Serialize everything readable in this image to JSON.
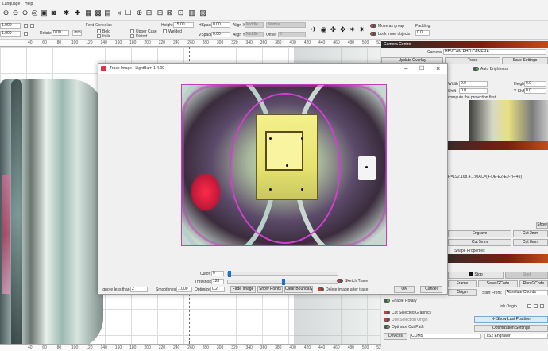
{
  "menu": {
    "items": [
      "Language",
      "Help"
    ]
  },
  "toolbar": {
    "icons": [
      "zoom-in",
      "zoom-out",
      "zoom-fit",
      "zoom-frame",
      "frame",
      "camera",
      "settings",
      "tools",
      "select",
      "trace",
      "text",
      "arrow",
      "position",
      "crosshair",
      "grid",
      "align",
      "arrange",
      "distribute"
    ]
  },
  "props": {
    "width_val": "1.000",
    "rotate_label": "Rotate",
    "rotate_val": "0.00",
    "unit": "mm",
    "font_label": "Font",
    "font_val": "Consolas",
    "height_label": "Height",
    "height_val": "15.00",
    "bold": "Bold",
    "italic": "Italic",
    "upper_case": "Upper Case",
    "distort": "Distort",
    "welded": "Welded",
    "hspace_label": "HSpace",
    "hspace_val": "0.00",
    "vspace_label": "VSpace",
    "vspace_val": "0.00",
    "alignx_label": "Align X",
    "alignx_val": "Middle",
    "aligny_label": "Align Y",
    "aligny_val": "Middle",
    "normal_label": "Normal",
    "offset_label": "Offset",
    "offset_val": "0",
    "move_as_group": "Move as group",
    "lock_inner": "Lock inner objects",
    "padding_label": "Padding:",
    "padding_val": "0.0"
  },
  "ruler": {
    "top": [
      "40",
      "60",
      "80",
      "100",
      "120",
      "140",
      "160",
      "180",
      "200",
      "220",
      "240",
      "260",
      "280",
      "300",
      "320",
      "340",
      "360",
      "380",
      "400",
      "420",
      "440",
      "460",
      "480",
      "500",
      "520"
    ],
    "bottom": [
      "40",
      "60",
      "80",
      "100",
      "120",
      "140",
      "160",
      "180",
      "200",
      "220",
      "240",
      "260",
      "280",
      "300",
      "320",
      "340",
      "360",
      "380",
      "400",
      "420",
      "440",
      "460",
      "480",
      "500",
      "520"
    ]
  },
  "camera": {
    "title": "Camera Control",
    "camera_label": "Camera:",
    "camera_val": "HBVCAM FHD CAMERA",
    "update_overlay": "Update Overlay",
    "trace": "Trace",
    "save_settings": "Save Settings",
    "auto_brightness": "Auto Brightness",
    "width_label": "Width",
    "width_val": "0.0",
    "height_label": "Height",
    "height_val": "0.0",
    "shift_label": "Shift",
    "shift_val": "0.0",
    "yshift_label": "Y Shift",
    "yshift_val": "0.0",
    "compute_note": "compute the projection first",
    "mac_text": "P=192.168.4.1:MAC=(4-DE-E2-E0-7F-49)"
  },
  "laser": {
    "show": "Show",
    "engrave": "Engrave",
    "cut2mm": "Cut 2mm",
    "cut5mm": "Cut 5mm",
    "cut8mm": "Cut 8mm",
    "shape_properties": "Shape Properties",
    "stop": "Stop",
    "start": "Start",
    "frame": "Frame",
    "save_gcode": "Save GCode",
    "run_gcode": "Run GCode",
    "origin": "Origin",
    "start_from_label": "Start From:",
    "start_from_val": "Absolute Coords",
    "job_origin": "Job Origin",
    "enable_rotary": "Enable Rotary",
    "cut_selected": "Cut Selected Graphics",
    "use_selection_origin": "Use Selection Origin",
    "optimize_cut_path": "Optimize Cut Path",
    "show_last_position": "Show Last Position",
    "optimization_settings": "Optimization Settings",
    "devices": "Devices",
    "port": "COM5",
    "device": "TS2 Engraver"
  },
  "dialog": {
    "title": "Trace Image - LightBurn 1.4.00",
    "cutoff_label": "Cutoff",
    "cutoff_val": "0",
    "threshold_label": "Threshold",
    "threshold_val": "128",
    "ignore_label": "Ignore less than",
    "ignore_val": "2",
    "smoothness_label": "Smoothness",
    "smoothness_val": "1.000",
    "optimize_label": "Optimize",
    "optimize_val": "0.2",
    "fade_image": "Fade Image",
    "show_points": "Show Points",
    "clear_boundary": "Clear Boundary",
    "sketch_trace": "Sketch Trace",
    "delete_image": "Delete image after trace",
    "ok": "OK",
    "cancel": "Cancel",
    "cutoff_fraction": 0.0,
    "threshold_fraction": 0.5
  }
}
